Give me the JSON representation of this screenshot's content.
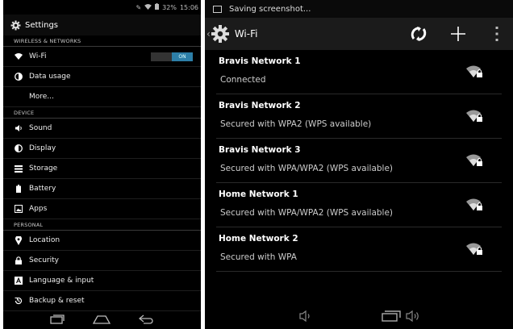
{
  "left": {
    "status_bar": {
      "battery": "32%",
      "time": "15:06"
    },
    "header": {
      "title": "Settings"
    },
    "sections": {
      "wireless": "WIRELESS & NETWORKS",
      "device": "DEVICE",
      "personal": "PERSONAL"
    },
    "items": {
      "wifi": "Wi-Fi",
      "wifi_toggle": "ON",
      "data_usage": "Data usage",
      "more": "More...",
      "sound": "Sound",
      "display": "Display",
      "storage": "Storage",
      "battery": "Battery",
      "apps": "Apps",
      "location": "Location",
      "security": "Security",
      "language": "Language & input",
      "backup": "Backup & reset"
    }
  },
  "right": {
    "notification": "Saving screenshot...",
    "action_bar": {
      "title": "Wi-Fi"
    },
    "networks": [
      {
        "ssid": "Bravis Network 1",
        "status": "Connected"
      },
      {
        "ssid": "Bravis Network 2",
        "status": "Secured with WPA2 (WPS available)"
      },
      {
        "ssid": "Bravis Network 3",
        "status": "Secured with WPA/WPA2 (WPS available)"
      },
      {
        "ssid": "Home Network 1",
        "status": "Secured with WPA/WPA2 (WPS available)"
      },
      {
        "ssid": "Home Network 2",
        "status": "Secured with WPA"
      }
    ]
  },
  "colors": {
    "toggle_on": "#2d7fa8",
    "background": "#000000"
  }
}
